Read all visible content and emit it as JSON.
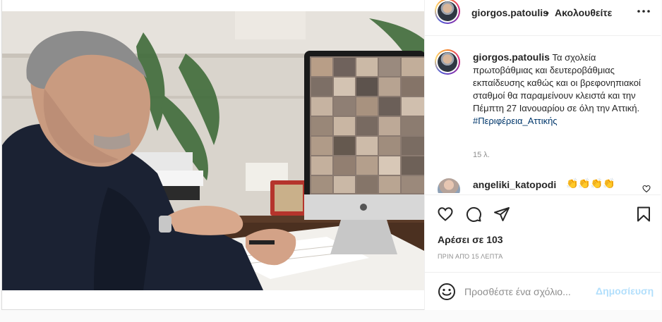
{
  "post": {
    "author": "giorgos.patoulis",
    "separator": "•",
    "follow_label": "Ακολουθείτε",
    "more_icon": "more-horizontal-icon",
    "caption_author": "giorgos.patoulis",
    "caption_text": "Τα σχολεία πρωτοβάθμιας και δευτεροβάθμιας εκπαίδευσης καθώς και οι βρεφονηπιακοί σταθμοί θα παραμείνουν κλειστά και την Πέμπτη 27 Ιανουαρίου σε όλη την Αττική.",
    "hashtag": "#Περιφέρεια_Αττικής",
    "age": "15 λ.",
    "likes": "Αρέσει σε 103",
    "timestamp": "ΠΡΙΝ ΑΠΌ 15 ΛΕΠΤΆ"
  },
  "comments": [
    {
      "user": "angeliki_katopodi",
      "text": "👏👏👏👏"
    }
  ],
  "actions": {
    "like_icon": "heart-icon",
    "comment_icon": "comment-icon",
    "share_icon": "share-icon",
    "save_icon": "bookmark-icon"
  },
  "add_comment": {
    "placeholder": "Προσθέστε ένα σχόλιο...",
    "post_label": "Δημοσίευση"
  }
}
